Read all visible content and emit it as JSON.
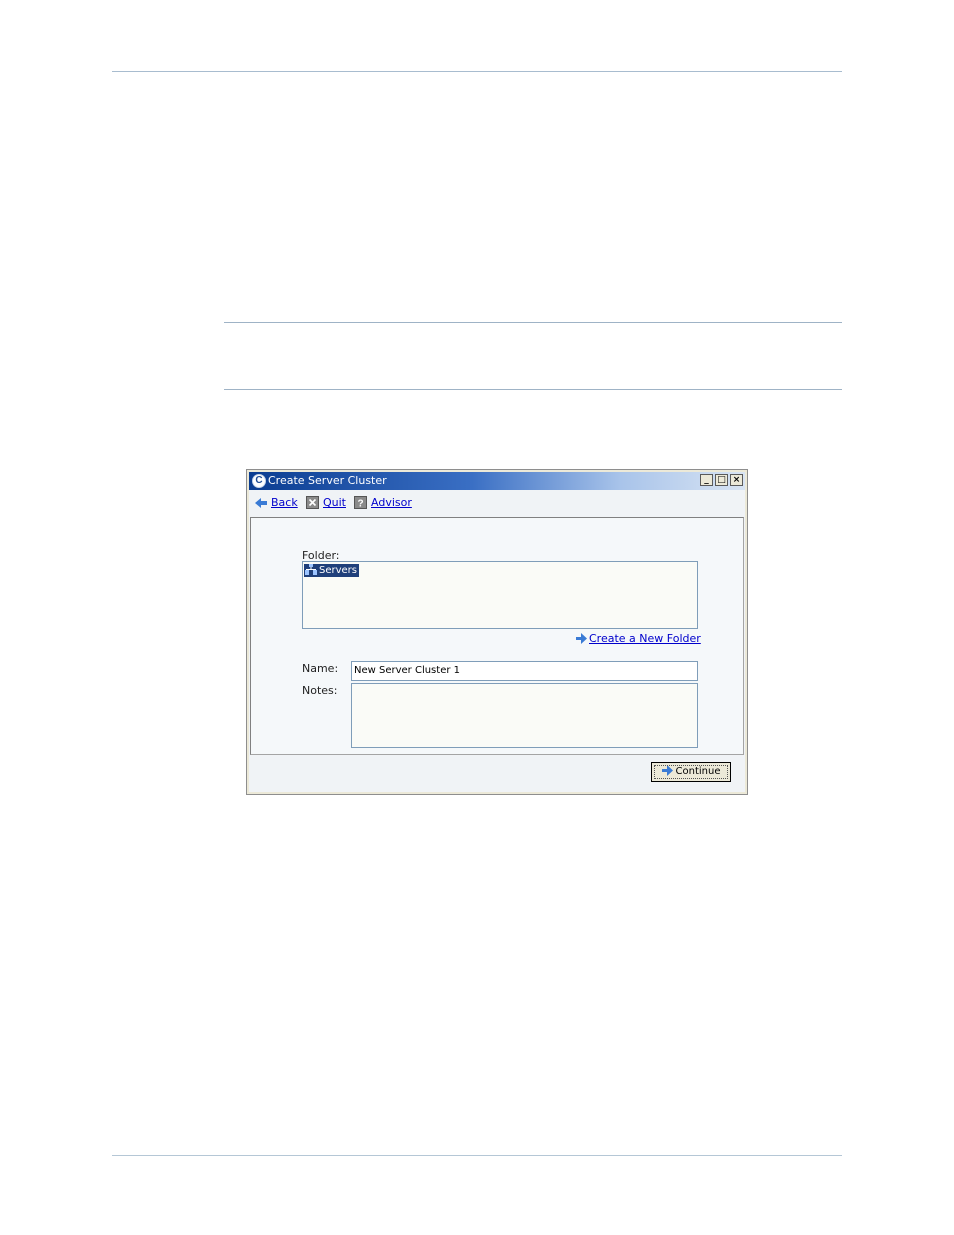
{
  "window": {
    "title": "Create Server Cluster",
    "app_icon_letter": "C",
    "controls": {
      "minimize": "_",
      "maximize": "□",
      "close": "×"
    }
  },
  "toolbar": {
    "back_label": "Back",
    "quit_label": "Quit",
    "advisor_label": "Advisor"
  },
  "form": {
    "folder_label": "Folder:",
    "folders": [
      {
        "label": "Servers",
        "selected": true,
        "icon": "servers-icon"
      }
    ],
    "create_folder_label": "Create a New Folder",
    "name_label": "Name:",
    "name_value": "New Server Cluster 1",
    "notes_label": "Notes:",
    "notes_value": ""
  },
  "footer": {
    "continue_label": "Continue"
  },
  "colors": {
    "title_gradient_start": "#0b3d91",
    "link": "#0000cc",
    "selection": "#1f3f7a",
    "rule": "#9fb3c6"
  }
}
